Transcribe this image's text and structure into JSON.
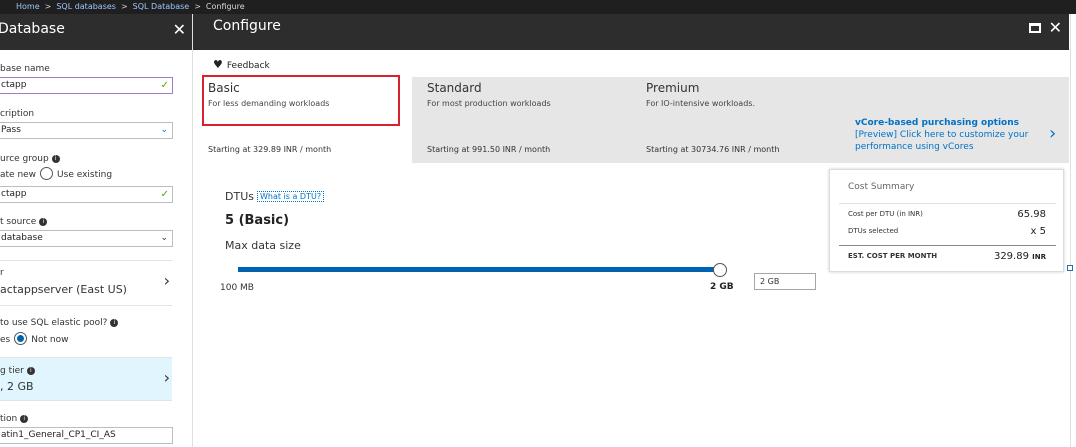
{
  "breadcrumb": {
    "items": [
      "Home",
      "SQL databases",
      "SQL Database"
    ],
    "current": "Configure",
    "separator": ">"
  },
  "left_panel": {
    "title": "Database",
    "close_glyph": "✕",
    "fields": {
      "database_name": {
        "label": "base name",
        "value": "ctapp"
      },
      "subscription": {
        "label": "cription",
        "value": "Pass"
      },
      "resource_group": {
        "label": "urce group",
        "option_new": "ate new",
        "option_existing": "Use existing",
        "value": "ctapp"
      },
      "source": {
        "label": "t source",
        "value": "database"
      },
      "server": {
        "label": "r",
        "value": "actappserver (East US)"
      },
      "elastic_pool": {
        "label": "to use SQL elastic pool?",
        "option_yes": "es",
        "option_no": "Not now"
      },
      "pricing_tier": {
        "label": "g tier",
        "value": ", 2 GB"
      },
      "collation": {
        "label": "tion",
        "value": "atin1_General_CP1_CI_AS"
      }
    }
  },
  "main": {
    "title": "Configure",
    "feedback_label": "Feedback",
    "tiers": [
      {
        "name": "Basic",
        "desc": "For less demanding workloads",
        "price": "Starting at 329.89 INR / month"
      },
      {
        "name": "Standard",
        "desc": "For most production workloads",
        "price": "Starting at 991.50 INR / month"
      },
      {
        "name": "Premium",
        "desc": "For IO-intensive workloads.",
        "price": "Starting at 30734.76 INR / month"
      }
    ],
    "vcore": {
      "heading": "vCore-based purchasing options",
      "line1": "[Preview] Click here to customize your",
      "line2": "performance using vCores"
    },
    "dtus_label": "DTUs",
    "dtu_link": "What is a DTU? ",
    "dtu_value": "5 (Basic)",
    "max_data_label": "Max data size",
    "slider": {
      "min_label": "100 MB",
      "max_label": "2 GB",
      "value_fraction": 1.0
    },
    "size_input": "2 GB",
    "cost_summary": {
      "title": "Cost Summary",
      "cost_per_dtu_label": "Cost per DTU (in INR)",
      "cost_per_dtu_value": "65.98",
      "dtus_selected_label": "DTUs selected",
      "dtus_selected_value": "x 5",
      "est_label": "EST. COST PER MONTH",
      "est_value": "329.89",
      "est_unit": "INR"
    }
  },
  "colors": {
    "accent": "#0072c6",
    "highlight": "#d9202e",
    "header": "#2d2d2d"
  }
}
